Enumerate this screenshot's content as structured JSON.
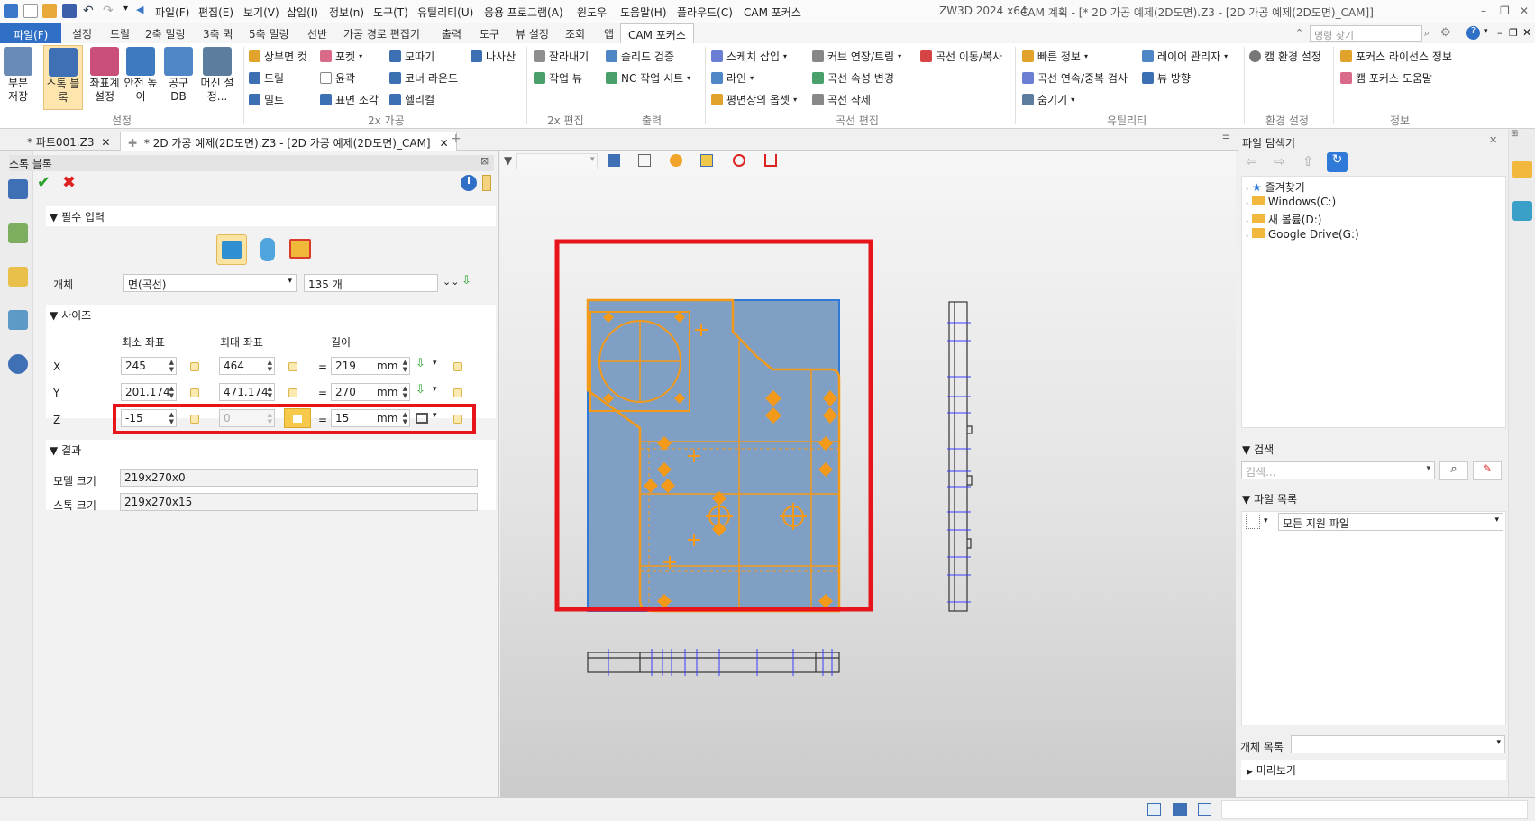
{
  "titlebar": {
    "menu": [
      "파일(F)",
      "편집(E)",
      "보기(V)",
      "삽입(I)",
      "정보(n)",
      "도구(T)",
      "유틸리티(U)",
      "응용 프로그램(A)",
      "윈도우",
      "도움말(H)",
      "플라우드(C)",
      "CAM 포커스"
    ],
    "app_name": "ZW3D 2024 x64",
    "document_title": "CAM 계획 - [* 2D 가공 예제(2D도면).Z3 - [2D 가공 예제(2D도면)_CAM]]"
  },
  "ribbon_tabs": {
    "file": "파일(F)",
    "tabs": [
      "설정",
      "드릴",
      "2축 밀링",
      "3축 퀵",
      "5축 밀링",
      "선반",
      "가공 경로 편집기",
      "출력",
      "도구",
      "뷰 설정",
      "조회",
      "앱"
    ],
    "active": "CAM 포커스",
    "command_search_placeholder": "명령 찾기"
  },
  "ribbon": {
    "setup": {
      "label": "설정",
      "buttons": [
        "부분 저장",
        "스톡 블록",
        "좌표계 설정",
        "안전 높이",
        "공구 DB",
        "머신 설정..."
      ]
    },
    "machining2x": {
      "label": "2x 가공",
      "col1": [
        "상부면 컷",
        "드릴",
        "밀트"
      ],
      "col2": [
        "포켓",
        "윤곽",
        "표면 조각"
      ],
      "col3": [
        "모따기",
        "코너 라운드",
        "헬리컬"
      ],
      "col4": [
        "나사산"
      ]
    },
    "edit2x": {
      "label": "2x 편집",
      "items": [
        "잘라내기",
        "작업 뷰"
      ]
    },
    "output": {
      "label": "출력",
      "items": [
        "솔리드 검증",
        "NC 작업 시트"
      ]
    },
    "curve_edit": {
      "label": "곡선 편집",
      "items": [
        "스케치 삽입",
        "커브 연장/트림",
        "곡선 이동/복사",
        "라인",
        "곡선 속성 변경",
        "평면상의 옵셋",
        "곡선 삭제"
      ]
    },
    "utility": {
      "label": "유틸리티",
      "items": [
        "빠른 정보",
        "레이어 관리자",
        "곡선 연속/중복 검사",
        "뷰 방향",
        "숨기기"
      ]
    },
    "env": {
      "label": "환경 설정",
      "items": [
        "캠 환경 설정"
      ]
    },
    "info": {
      "label": "정보",
      "items": [
        "포커스 라이선스 정보",
        "캠 포커스 도움말"
      ]
    }
  },
  "doc_tabs": [
    "* 파트001.Z3",
    "* 2D 가공 예제(2D도면).Z3 - [2D 가공 예제(2D도면)_CAM]"
  ],
  "panel": {
    "title": "스톡 블록",
    "required_section": "필수 입력",
    "entity_label": "개체",
    "entity_type": "면(곡선)",
    "entity_count": "135 개",
    "size_section": "사이즈",
    "col_min": "최소 좌표",
    "col_max": "최대 좌표",
    "col_len": "길이",
    "rows": [
      {
        "axis": "X",
        "min": "245",
        "max": "464",
        "len": "219",
        "unit": "mm"
      },
      {
        "axis": "Y",
        "min": "201.174",
        "max": "471.174",
        "len": "270",
        "unit": "mm"
      },
      {
        "axis": "Z",
        "min": "-15",
        "max": "0",
        "len": "15",
        "unit": "mm"
      }
    ],
    "eq": "=",
    "result_section": "결과",
    "model_size_label": "모델 크기",
    "model_size": "219x270x0",
    "stock_size_label": "스톡 크기",
    "stock_size": "219x270x15"
  },
  "file_browser": {
    "title": "파일 탐색기",
    "tree": [
      "즐겨찾기",
      "Windows(C:)",
      "새 볼륨(D:)",
      "Google Drive(G:)"
    ],
    "search_section": "검색",
    "search_placeholder": "검색...",
    "file_list_section": "파일 목록",
    "file_filter": "모든 지원 파일",
    "entity_list_label": "개체 목록",
    "preview_section": "미리보기"
  },
  "colors": {
    "accent": "#2f6fc5",
    "highlight_red": "#e8141c",
    "part_orange": "#f39a1a",
    "stock_blue": "#7f9fc4"
  }
}
